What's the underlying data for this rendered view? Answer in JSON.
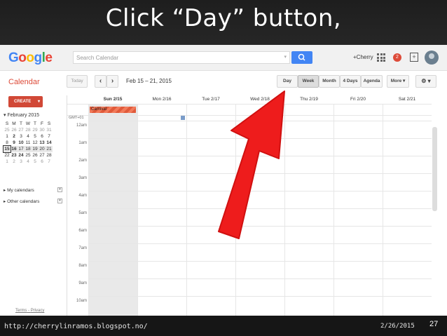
{
  "slide": {
    "title": "Click “Day” button,",
    "url": "http://cherrylinramos.blogspot.no/",
    "date": "2/26/2015",
    "page_number": "27"
  },
  "topbar": {
    "logo": [
      "G",
      "o",
      "o",
      "g",
      "l",
      "e"
    ],
    "search_placeholder": "Search Calendar",
    "user_label": "+Cherry",
    "notification_count": "2",
    "icons": [
      "search-icon",
      "apps-grid-icon",
      "notification-icon",
      "share-icon",
      "avatar"
    ]
  },
  "toolbar": {
    "app_title": "Calendar",
    "today_label": "Today",
    "prev_label": "‹",
    "next_label": "›",
    "date_range": "Feb 15 – 21, 2015",
    "views": [
      "Day",
      "Week",
      "Month",
      "4 Days",
      "Agenda"
    ],
    "selected_view": "Week",
    "more_label": "More ▾",
    "settings_label": "⚙ ▾"
  },
  "sidebar": {
    "create_label": "CREATE",
    "mini_month": "February 2015",
    "weekdays": [
      "S",
      "M",
      "T",
      "W",
      "T",
      "F",
      "S"
    ],
    "weeks": [
      [
        "25",
        "26",
        "27",
        "28",
        "29",
        "30",
        "31"
      ],
      [
        "1",
        "2",
        "3",
        "4",
        "5",
        "6",
        "7"
      ],
      [
        "8",
        "9",
        "10",
        "11",
        "12",
        "13",
        "14"
      ],
      [
        "15",
        "16",
        "17",
        "18",
        "19",
        "20",
        "21"
      ],
      [
        "22",
        "23",
        "24",
        "25",
        "26",
        "27",
        "28"
      ],
      [
        "1",
        "2",
        "3",
        "4",
        "5",
        "6",
        "7"
      ]
    ],
    "my_calendars": "My calendars",
    "other_calendars": "Other calendars",
    "terms": "Terms",
    "privacy": "Privacy",
    "terms_sep": " - "
  },
  "grid": {
    "timezone": "GMT+01",
    "days": [
      "Sun 2/15",
      "Mon 2/16",
      "Tue 2/17",
      "Wed 2/18",
      "Thu 2/19",
      "Fri 2/20",
      "Sat 2/21"
    ],
    "hours": [
      "12am",
      "1am",
      "2am",
      "3am",
      "4am",
      "5am",
      "6am",
      "7am",
      "8am",
      "9am",
      "10am"
    ],
    "all_day_event": "Carnival"
  },
  "colors": {
    "accent_red": "#dd4b39",
    "arrow_red": "#ee1c1c",
    "search_blue": "#4285f4"
  }
}
